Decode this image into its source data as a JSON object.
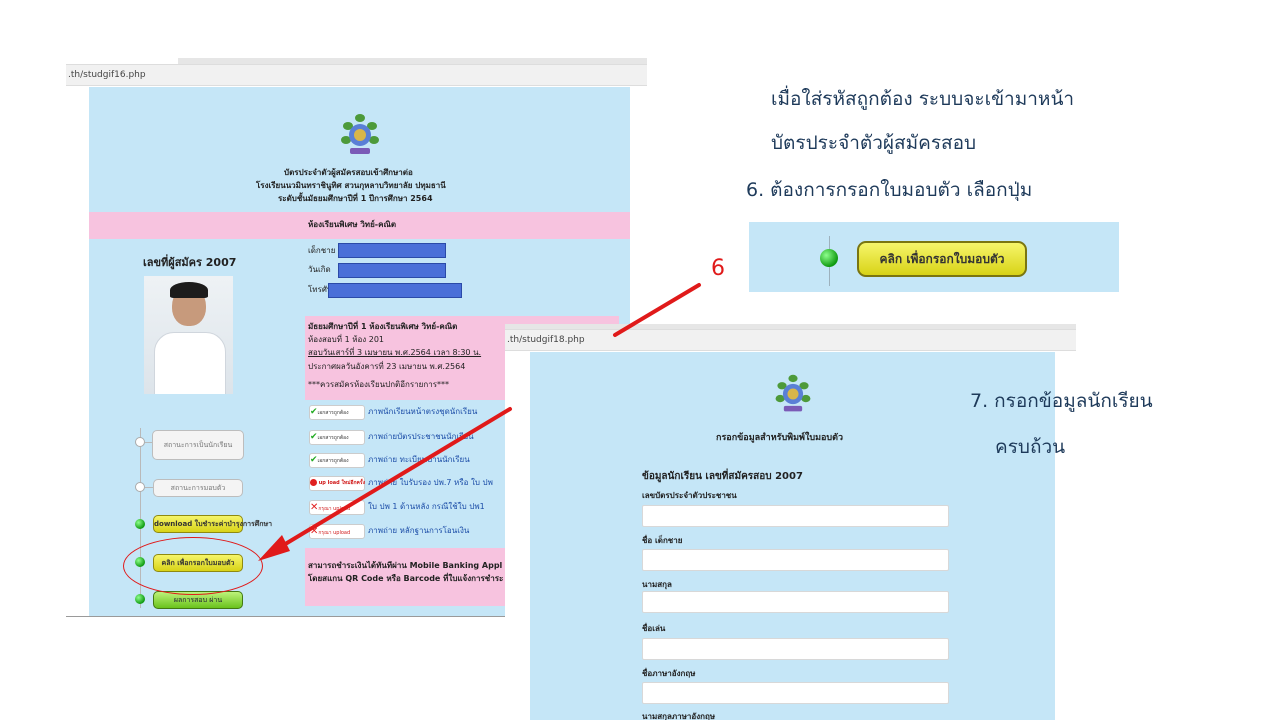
{
  "screenshot1": {
    "url": ".th/studgif16.php",
    "header": {
      "line1": "บัตรประจำตัวผู้สมัครสอบเข้าศึกษาต่อ",
      "line2": "โรงเรียนนวมินทราชินูทิศ สวนกุหลาบวิทยาลัย ปทุมธานี",
      "line3": "ระดับชั้นมัธยมศึกษาปีที่ 1 ปีการศึกษา 2564"
    },
    "room_band": "ห้องเรียนพิเศษ วิทย์-คณิต",
    "applicant_no": "เลขที่ผู้สมัคร 2007",
    "labels": {
      "name": "เด็กชาย",
      "dob": "วันเกิด",
      "phone": "โทรศัพท์"
    },
    "exam": {
      "title": "มัธยมศึกษาปีที่ 1 ห้องเรียนพิเศษ วิทย์-คณิต",
      "room": "ห้องสอบที่ 1 ห้อง 201",
      "date": "สอบวันเสาร์ที่ 3 เมษายน พ.ศ.2564 เวลา 8:30 น.",
      "result": "ประกาศผลวันอังคารที่ 23 เมษายน พ.ศ.2564",
      "note": "***ควรสมัครห้องเรียนปกติอีกรายการ***"
    },
    "documents": [
      {
        "badge": "เอกสารถูกต้อง",
        "status": "ok",
        "text": "ภาพนักเรียนหน้าตรงชุดนักเรียน"
      },
      {
        "badge": "เอกสารถูกต้อง",
        "status": "ok",
        "text": "ภาพถ่ายบัตรประชาชนนักเรียน"
      },
      {
        "badge": "เอกสารถูกต้อง",
        "status": "ok",
        "text": "ภาพถ่าย ทะเบียนบ้านนักเรียน"
      },
      {
        "badge": "up load ใหม่อีกครั้ง",
        "status": "reupload",
        "text": "ภาพถ่าย ใบรับรอง ปพ.7 หรือ ใบ ปพ"
      },
      {
        "badge": "กรุณา upload",
        "status": "missing",
        "text": "ใบ ปพ 1 ด้านหลัง กรณีใช้ใบ ปพ1"
      },
      {
        "badge": "กรุณา upload",
        "status": "missing",
        "text": "ภาพถ่าย หลักฐานการโอนเงิน"
      }
    ],
    "payment": {
      "line1": "สามารถชำระเงินได้ทันทีผ่าน Mobile Banking Appl",
      "line2": "โดยสแกน QR Code หรือ Barcode ที่ใบแจ้งการชำระ"
    },
    "timeline": [
      {
        "label": "สถานะการเป็นนักเรียน",
        "style": "gray"
      },
      {
        "label": "สถานะการมอบตัว",
        "style": "gray"
      },
      {
        "label": "download ใบชำระค่าบำรุงการศึกษา",
        "style": "yellow"
      },
      {
        "label": "คลิก เพื่อกรอกใบมอบตัว",
        "style": "yellow"
      },
      {
        "label": "ผลการสอบ ผ่าน",
        "style": "green"
      }
    ]
  },
  "callout_button": "คลิก เพื่อกรอกใบมอบตัว",
  "step_number": "6",
  "notes": {
    "line1": "เมื่อใส่รหัสถูกต้อง ระบบจะเข้ามาหน้า",
    "line2": "บัตรประจำตัวผู้สมัครสอบ",
    "line3": "6. ต้องการกรอกใบมอบตัว เลือกปุ่ม",
    "line4": "7. กรอกข้อมูลนักเรียน",
    "line5": "ครบถ้วน"
  },
  "screenshot2": {
    "url": ".th/studgif18.php",
    "form_title": "กรอกข้อมูลสำหรับพิมพ์ใบมอบตัว",
    "section_title": "ข้อมูลนักเรียน เลขที่สมัครสอบ 2007",
    "fields": [
      {
        "label": "เลขบัตรประจำตัวประชาชน",
        "value": ""
      },
      {
        "label": "ชื่อ เด็กชาย",
        "value": ""
      },
      {
        "label": "นามสกุล",
        "value": ""
      },
      {
        "label": "ชื่อเล่น",
        "value": ""
      },
      {
        "label": "ชื่อภาษาอังกฤษ",
        "value": ""
      },
      {
        "label": "นามสกุลภาษาอังกฤษ",
        "value": ""
      }
    ]
  },
  "colors": {
    "panel": "#c5e6f7",
    "pink": "#f7c3df",
    "arrow": "#e01a1a",
    "note_text": "#1e3a5a"
  }
}
